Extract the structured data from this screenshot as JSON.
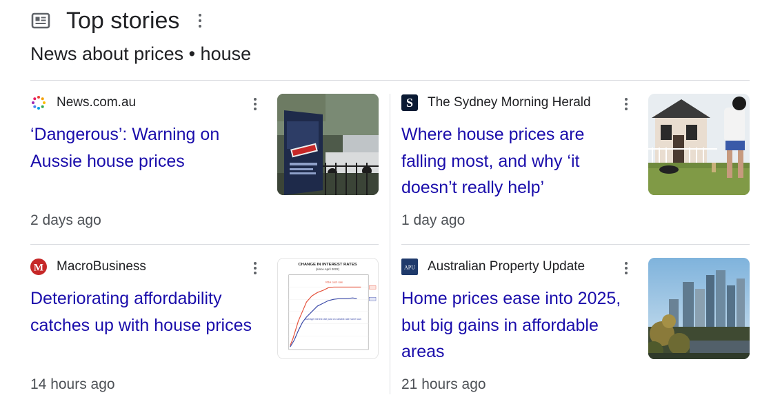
{
  "header": {
    "title": "Top stories",
    "subtitle": "News about prices • house"
  },
  "cards": [
    {
      "source": "News.com.au",
      "headline": "‘Dangerous’: Warning on Aussie house prices",
      "time": "2 days ago",
      "image": "sold-sign-photo"
    },
    {
      "source": "The Sydney Morning Herald",
      "headline": "Where house prices are falling most, and why ‘it doesn’t really help’",
      "time": "1 day ago",
      "image": "terrace-house-photo"
    },
    {
      "source": "MacroBusiness",
      "headline": "Deteriorating affordability catches up with house prices",
      "time": "14 hours ago",
      "image": "interest-rates-chart",
      "image_text": {
        "title": "CHANGE IN INTEREST RATES",
        "subtitle": "(since April 2022)",
        "series_label_1": "RBA cash rate",
        "series_label_2": "Average interest rate paid on variable-rate home loan"
      }
    },
    {
      "source": "Australian Property Update",
      "source_logo_text": "APU",
      "headline": "Home prices ease into 2025, but big gains in affordable areas",
      "time": "21 hours ago",
      "image": "city-skyline-photo"
    }
  ],
  "colors": {
    "headline": "#1a0dab",
    "divider": "#dadce0",
    "muted": "#4d5156"
  }
}
